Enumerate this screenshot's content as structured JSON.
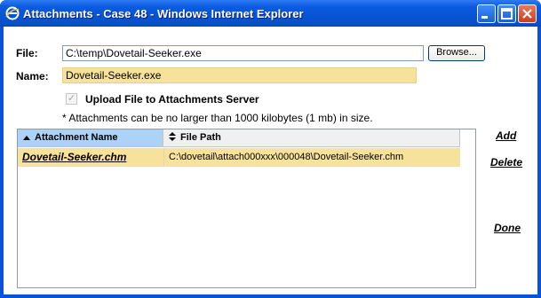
{
  "window": {
    "title": "Attachments - Case 48 - Windows Internet Explorer"
  },
  "form": {
    "file_label": "File:",
    "file_value": "C:\\temp\\Dovetail-Seeker.exe",
    "browse_label": "Browse...",
    "name_label": "Name:",
    "name_value": "Dovetail-Seeker.exe",
    "upload_label": "Upload File to Attachments Server",
    "upload_checked": true,
    "size_note": "* Attachments can be no larger than 1000 kilobytes (1 mb) in size."
  },
  "grid": {
    "columns": [
      {
        "label": "Attachment Name",
        "sort": "ascending"
      },
      {
        "label": "File Path",
        "sort": "none"
      }
    ],
    "rows": [
      {
        "name": "Dovetail-Seeker.chm",
        "path": "C:\\dovetail\\attach000xxx\\000048\\Dovetail-Seeker.chm"
      }
    ]
  },
  "actions": {
    "add": "Add",
    "delete": "Delete",
    "done": "Done"
  },
  "colors": {
    "titlebar": "#0a5be0",
    "selected_row": "#f7e29b",
    "sorted_header": "#abd2f7"
  }
}
